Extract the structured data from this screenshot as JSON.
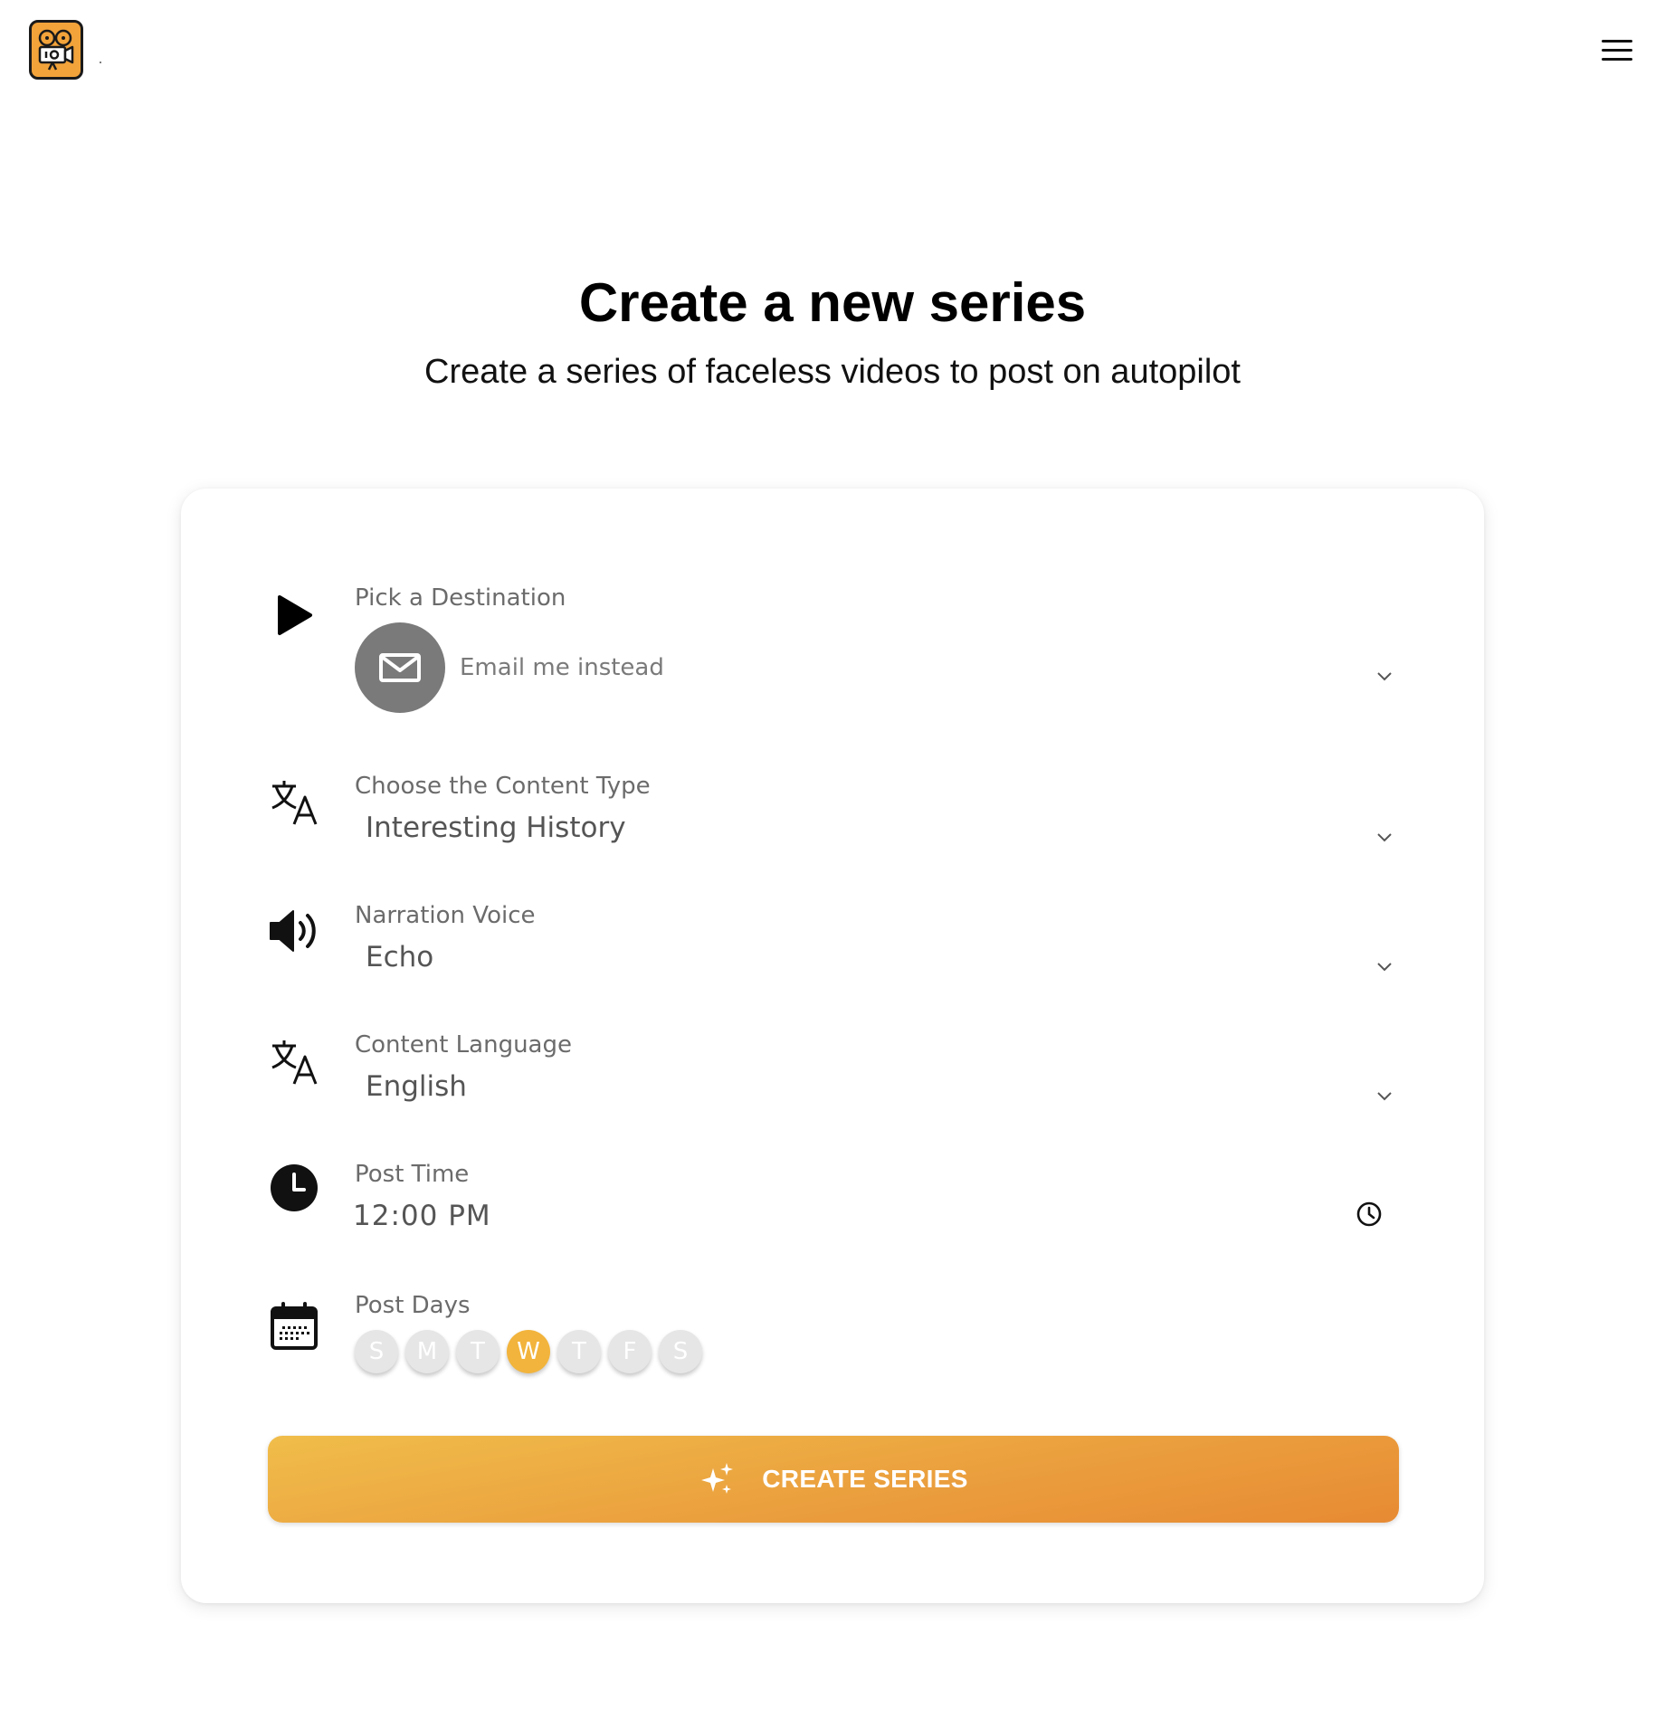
{
  "header": {
    "logo_icon": "movie-camera-logo",
    "menu_icon": "hamburger-menu-icon"
  },
  "page": {
    "title": "Create a new series",
    "subtitle": "Create a series of faceless videos to post on autopilot"
  },
  "form": {
    "destination": {
      "label": "Pick a Destination",
      "value": "Email me instead",
      "icon": "play-icon"
    },
    "content_type": {
      "label": "Choose the Content Type",
      "value": "Interesting History",
      "icon": "translate-icon"
    },
    "narration_voice": {
      "label": "Narration Voice",
      "value": "Echo",
      "icon": "speaker-icon"
    },
    "content_language": {
      "label": "Content Language",
      "value": "English",
      "icon": "translate-icon"
    },
    "post_time": {
      "label": "Post Time",
      "value": "12:00 PM",
      "icon": "clock-icon"
    },
    "post_days": {
      "label": "Post Days",
      "icon": "calendar-icon",
      "days": [
        {
          "letter": "S",
          "selected": false
        },
        {
          "letter": "M",
          "selected": false
        },
        {
          "letter": "T",
          "selected": false
        },
        {
          "letter": "W",
          "selected": true
        },
        {
          "letter": "T",
          "selected": false
        },
        {
          "letter": "F",
          "selected": false
        },
        {
          "letter": "S",
          "selected": false
        }
      ]
    },
    "submit_label": "CREATE SERIES"
  },
  "colors": {
    "accent": "#f2b43c",
    "button_gradient_start": "#f0bd4a",
    "button_gradient_end": "#e78a33",
    "day_inactive": "#e6e6e6"
  }
}
